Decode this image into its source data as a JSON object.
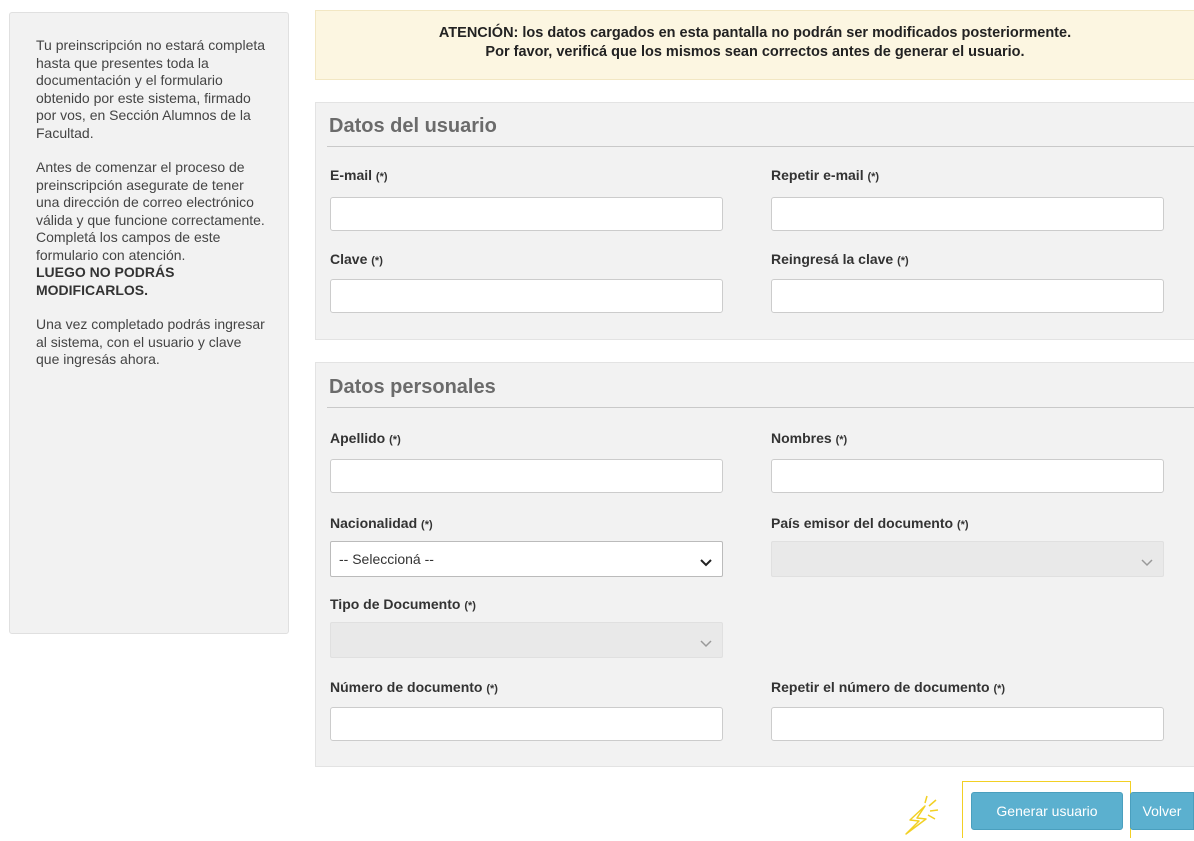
{
  "sidebar": {
    "paragraph1": "Tu preinscripción no estará completa hasta que presentes toda la documentación y el formulario obtenido por este sistema, firmado por vos, en Sección Alumnos de la Facultad.",
    "paragraph2": "Antes de comenzar el proceso de preinscripción asegurate de tener una dirección de correo electrónico válida y que funcione correctamente. Completá los campos de este formulario con atención.",
    "paragraph2_bold": "LUEGO NO PODRÁS MODIFICARLOS.",
    "paragraph3": "Una vez completado podrás ingresar al sistema, con el usuario y clave que ingresás ahora."
  },
  "notice": {
    "line1": "ATENCIÓN: los datos cargados en esta pantalla no podrán ser modificados posteriormente.",
    "line2": "Por favor, verificá que los mismos sean correctos antes de generar el usuario."
  },
  "user_section": {
    "title": "Datos del usuario",
    "email_label": "E-mail",
    "repeat_email_label": "Repetir e-mail",
    "password_label": "Clave",
    "repeat_password_label": "Reingresá la clave",
    "email_value": "",
    "repeat_email_value": "",
    "password_value": "",
    "repeat_password_value": ""
  },
  "personal_section": {
    "title": "Datos personales",
    "apellido_label": "Apellido",
    "nombres_label": "Nombres",
    "nacionalidad_label": "Nacionalidad",
    "nacionalidad_value": "-- Seleccioná --",
    "pais_emisor_label": "País emisor del documento",
    "pais_emisor_value": "",
    "tipo_documento_label": "Tipo de Documento",
    "tipo_documento_value": "",
    "numero_documento_label": "Número de documento",
    "repetir_numero_label": "Repetir el número de documento",
    "apellido_value": "",
    "nombres_value": "",
    "numero_documento_value": "",
    "repetir_numero_value": ""
  },
  "required_marker": "(*)",
  "buttons": {
    "generar": "Generar usuario",
    "volver": "Volver"
  },
  "colors": {
    "button": "#5bb0cf",
    "notice_bg": "#fcf6e1",
    "section_bg": "#f2f2f2",
    "highlight": "#f2d024"
  },
  "icons": {
    "select_arrow": "chevron-down-icon",
    "cursor": "click-cursor-icon"
  }
}
